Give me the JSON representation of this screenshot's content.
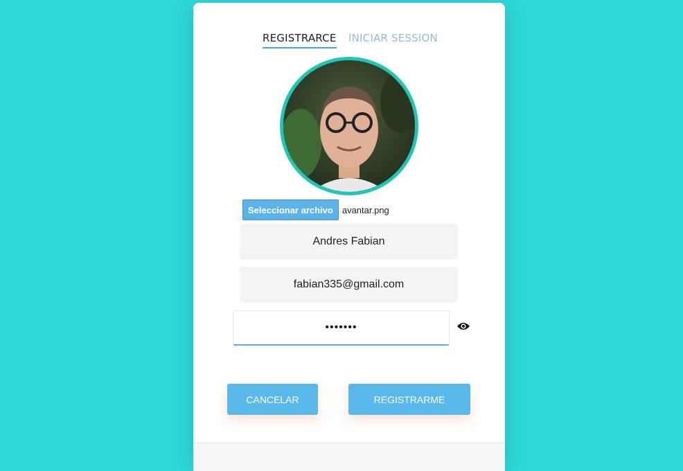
{
  "tabs": [
    {
      "label": "REGISTRARCE",
      "active": true
    },
    {
      "label": "INICIAR SESSION",
      "active": false
    }
  ],
  "avatar": {
    "alt": "profile photo"
  },
  "file_input": {
    "button_label": "Seleccionar archivo",
    "file_name": "avantar.png"
  },
  "form": {
    "name_value": "Andres Fabian",
    "email_value": "fabian335@gmail.com",
    "password_value": "•••••••",
    "toggle_icon": "eye-icon"
  },
  "buttons": {
    "cancel_label": "CANCELAR",
    "register_label": "REGISTRARME"
  },
  "colors": {
    "background": "#2dd9d9",
    "accent": "#5ab8ea",
    "avatar_ring": "#1fc7b6"
  }
}
